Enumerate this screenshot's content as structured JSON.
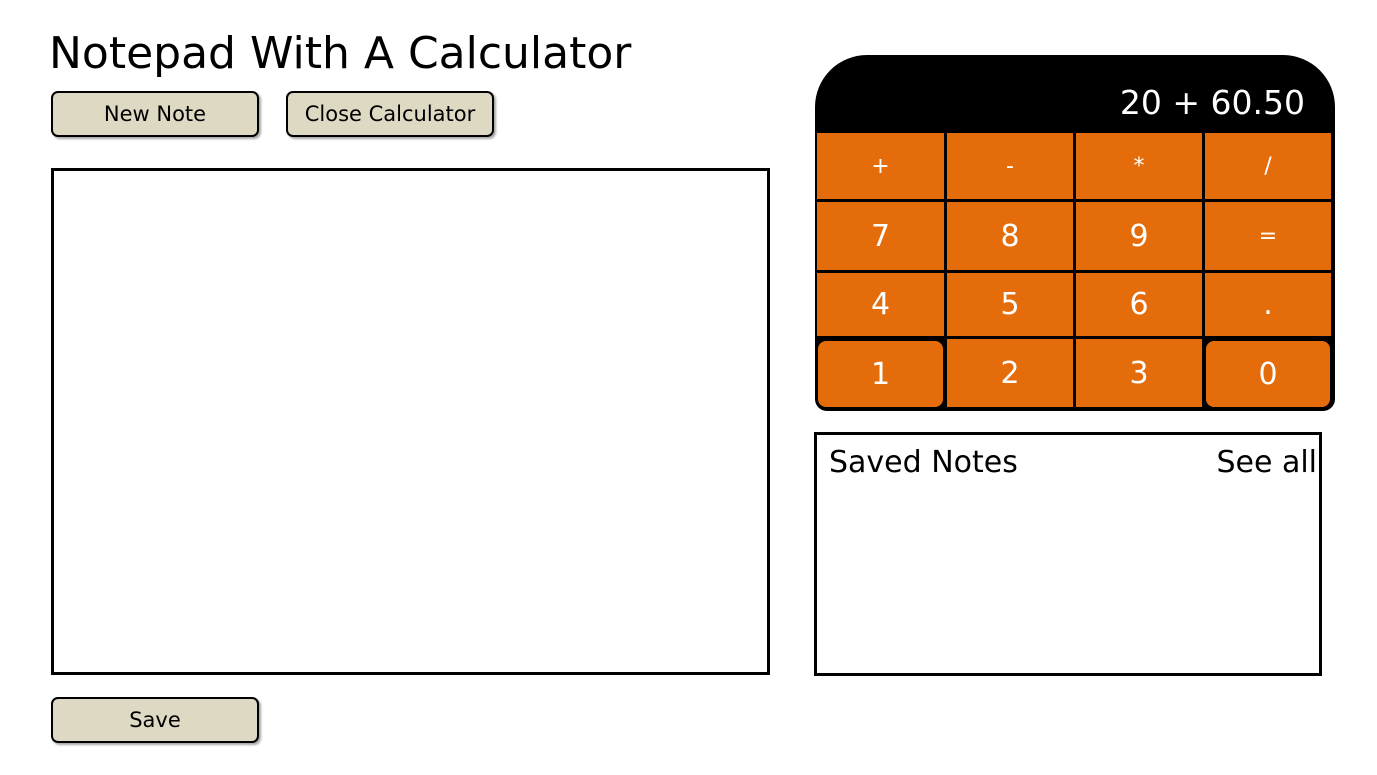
{
  "header": {
    "title": "Notepad With A Calculator"
  },
  "toolbar": {
    "new_note_label": "New Note",
    "close_calculator_label": "Close Calculator"
  },
  "editor": {
    "value": "",
    "placeholder": ""
  },
  "footer": {
    "save_label": "Save"
  },
  "calculator": {
    "display": "20 + 60.50",
    "keys": [
      [
        "+",
        "-",
        "*",
        "/"
      ],
      [
        "7",
        "8",
        "9",
        "="
      ],
      [
        "4",
        "5",
        "6",
        "."
      ],
      [
        "1",
        "2",
        "3",
        "0"
      ]
    ],
    "colors": {
      "body": "#000000",
      "key": "#e46c0a",
      "key_text": "#ffffff"
    }
  },
  "saved_notes": {
    "title": "Saved Notes",
    "see_all_label": "See all",
    "items": []
  },
  "colors": {
    "button_bg": "#ddd9c3"
  }
}
